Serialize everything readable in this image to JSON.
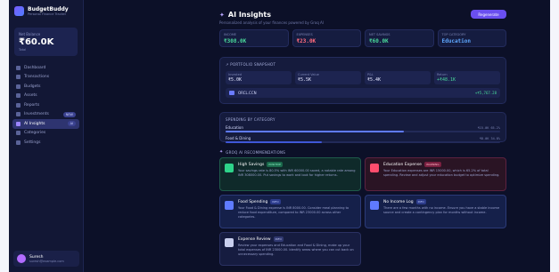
{
  "brand": {
    "name": "BudgetBuddy",
    "tagline": "Personal Finance Tracker"
  },
  "balance": {
    "label": "Net Balance",
    "value": "₹60.0K",
    "sub": "Total"
  },
  "sidebar": {
    "items": [
      {
        "label": "Dashboard",
        "badge": ""
      },
      {
        "label": "Transactions",
        "badge": ""
      },
      {
        "label": "Budgets",
        "badge": ""
      },
      {
        "label": "Assets",
        "badge": ""
      },
      {
        "label": "Reports",
        "badge": ""
      },
      {
        "label": "Investments",
        "badge": "NEW"
      },
      {
        "label": "AI Insights",
        "badge": "AI"
      },
      {
        "label": "Categories",
        "badge": ""
      },
      {
        "label": "Settings",
        "badge": ""
      }
    ],
    "active_index": 6
  },
  "user": {
    "name": "Suresh",
    "email": "suresh@example.com"
  },
  "header": {
    "title": "AI Insights",
    "subtitle": "Personalized analysis of your finances powered by Groq AI",
    "regenerate_label": "Regenerate"
  },
  "stats": [
    {
      "label": "Income",
      "value": "₹308.0K",
      "color": "#49d89a"
    },
    {
      "label": "Expenses",
      "value": "₹23.0K",
      "color": "#ff6b7d"
    },
    {
      "label": "Net Savings",
      "value": "₹60.0K",
      "color": "#49d89a"
    },
    {
      "label": "Top Category",
      "value": "Education",
      "color": "#5fa8ff"
    }
  ],
  "portfolio": {
    "title": "Portfolio Snapshot",
    "metrics": [
      {
        "label": "Invested",
        "value": "₹5.0K"
      },
      {
        "label": "Current Value",
        "value": "₹5.5K"
      },
      {
        "label": "P&L",
        "value": "₹5.4K"
      },
      {
        "label": "Return",
        "value": "+₹48.1K"
      }
    ],
    "holding": {
      "name": "ORCL.CCN",
      "amount": "+₹5,767.28"
    }
  },
  "category": {
    "title": "Spending by Category",
    "rows": [
      {
        "name": "Education",
        "amount": "₹15.0K 65.2%",
        "fill": 0.65,
        "color": "#5f7bff"
      },
      {
        "name": "Food & Dining",
        "amount": "₹8.0K 34.8%",
        "fill": 0.35,
        "color": "#3f57d8"
      }
    ]
  },
  "recommendations": {
    "title": "Groq AI Recommendations",
    "items": [
      {
        "style": "green",
        "title": "High Savings",
        "pill": "POSITIVE",
        "body": "Your savings rate is 80.5% with INR 60000.00 saved, a notable rate among INR 308000.00. Put savings to work and look for higher returns."
      },
      {
        "style": "red",
        "title": "Education Expense",
        "pill": "WARNING",
        "body": "Your Education expenses are INR 15000.00, which is 65.2% of total spending. Review and adjust your education budget to optimize spending."
      },
      {
        "style": "blue",
        "title": "Food Spending",
        "pill": "INFO",
        "body": "Your Food & Dining expense is INR 8000.00. Consider meal planning to reduce food expenditure, compared to INR 23000.00 across other categories."
      },
      {
        "style": "blue",
        "title": "No Income Log",
        "pill": "INFO",
        "body": "There are a few months with no income. Ensure you have a stable income source and create a contingency plan for months without income."
      },
      {
        "style": "gray",
        "title": "Expense Review",
        "pill": "INFO",
        "body": "Review your expenses and Education and Food & Dining, make up your total expenses of INR 23000.00. Identify areas where you can cut back on unnecessary spending."
      }
    ]
  }
}
